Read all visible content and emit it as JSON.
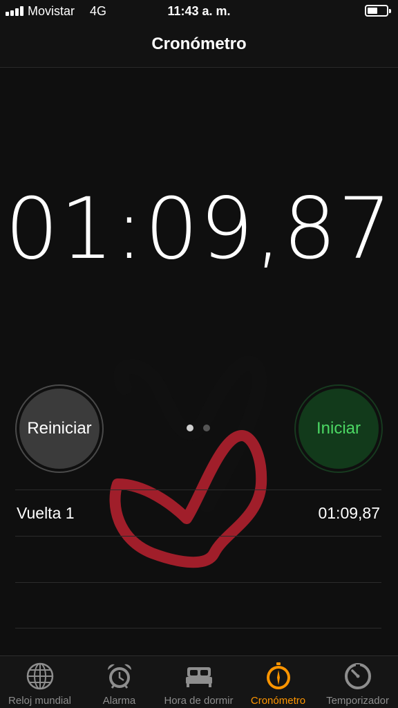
{
  "status_bar": {
    "carrier": "Movistar",
    "network": "4G",
    "time": "11:43 a. m.",
    "signal_icon": "signal-bars-icon",
    "battery_icon": "battery-icon"
  },
  "nav": {
    "title": "Cronómetro"
  },
  "stopwatch": {
    "display": "01:09,87"
  },
  "buttons": {
    "reset_label": "Reiniciar",
    "start_label": "Iniciar"
  },
  "page_indicator": {
    "pages": 2,
    "current": 1
  },
  "laps": [
    {
      "label": "Vuelta 1",
      "time": "01:09,87"
    }
  ],
  "tabs": [
    {
      "label": "Reloj mundial",
      "icon": "globe-icon"
    },
    {
      "label": "Alarma",
      "icon": "alarm-clock-icon"
    },
    {
      "label": "Hora de dormir",
      "icon": "bed-icon"
    },
    {
      "label": "Cronómetro",
      "icon": "stopwatch-icon",
      "active": true
    },
    {
      "label": "Temporizador",
      "icon": "timer-icon"
    }
  ],
  "colors": {
    "accent": "#ff9500",
    "start_green": "#4cd964",
    "background": "#0f0f0f"
  }
}
